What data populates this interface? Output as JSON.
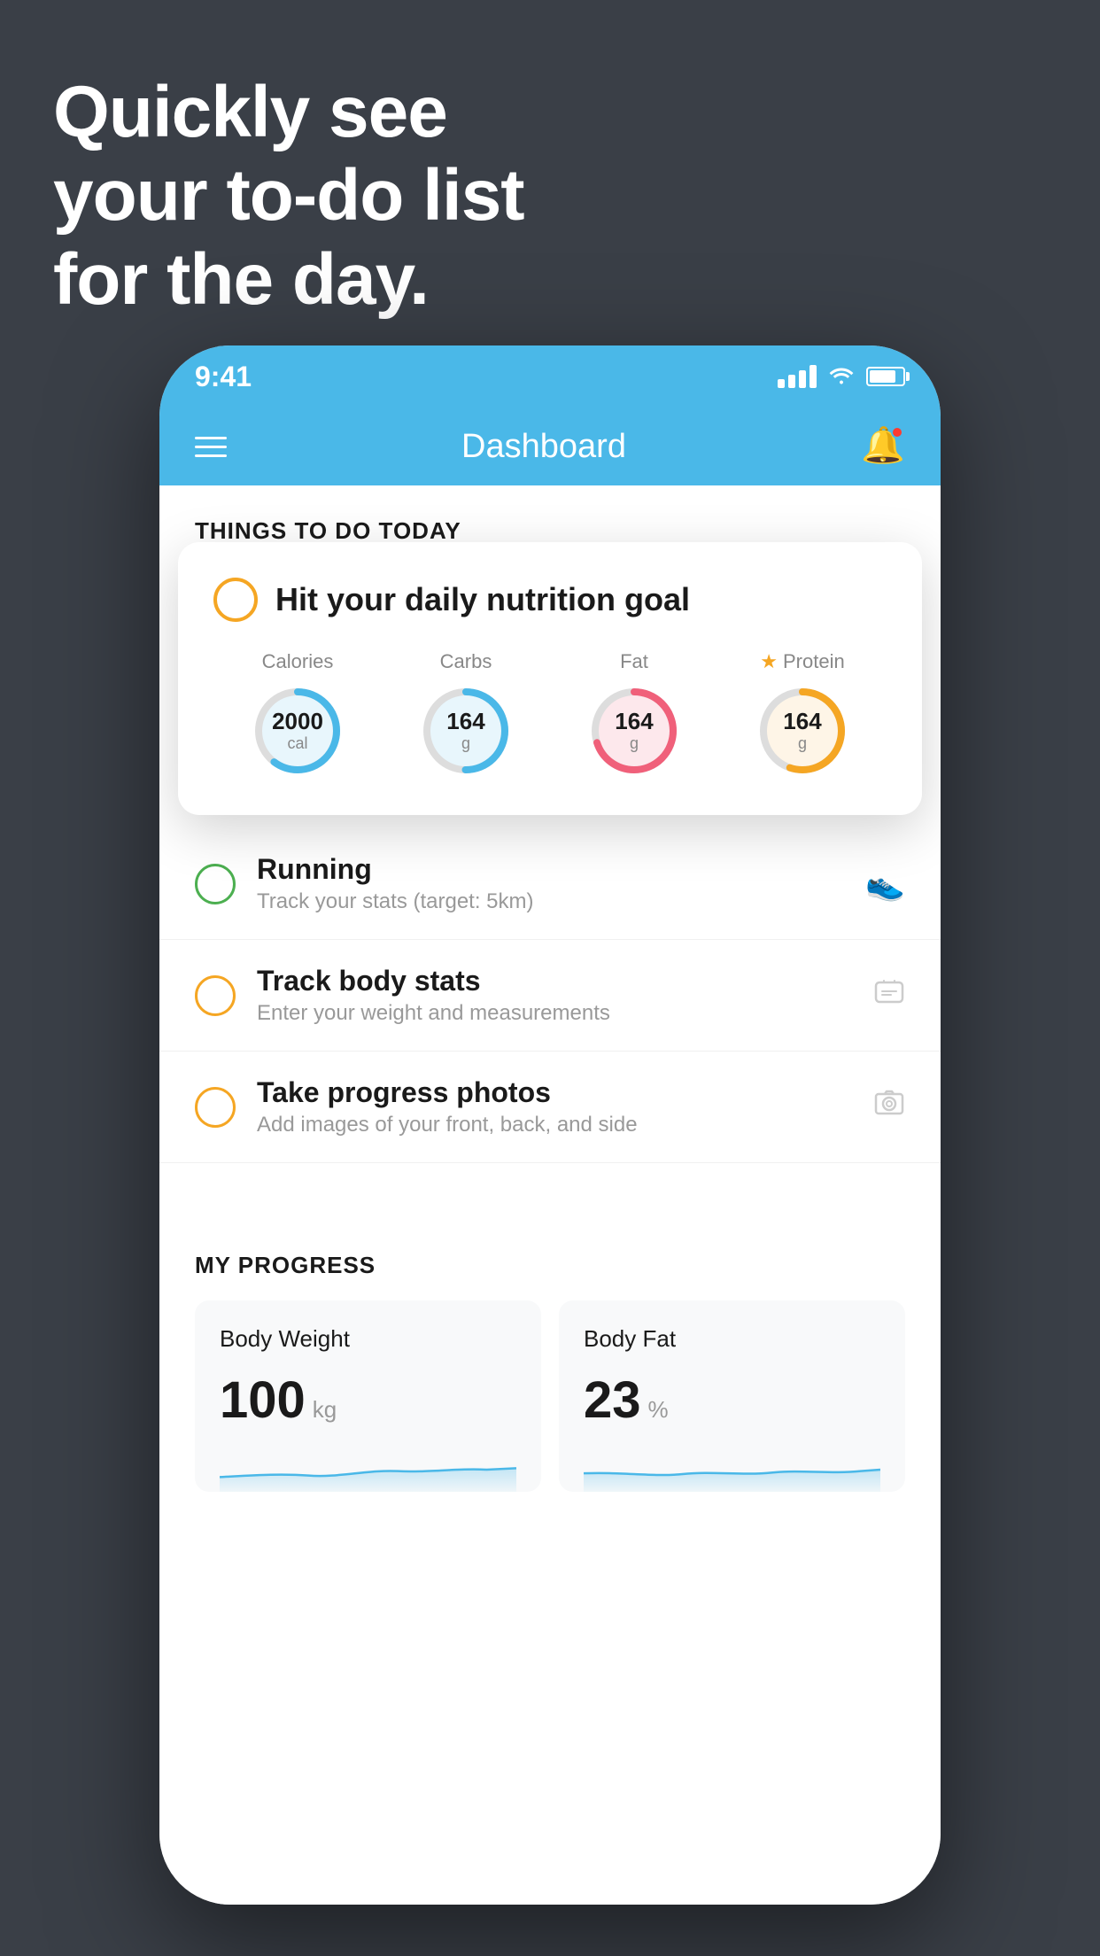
{
  "headline": {
    "line1": "Quickly see",
    "line2": "your to-do list",
    "line3": "for the day."
  },
  "phone": {
    "statusBar": {
      "time": "9:41"
    },
    "navBar": {
      "title": "Dashboard"
    },
    "sectionHeader": "THINGS TO DO TODAY",
    "floatingCard": {
      "title": "Hit your daily nutrition goal",
      "nutrition": [
        {
          "label": "Calories",
          "value": "2000",
          "unit": "cal",
          "color": "#4ab8e8",
          "bgColor": "#e8f6fc",
          "percent": 60,
          "star": false
        },
        {
          "label": "Carbs",
          "value": "164",
          "unit": "g",
          "color": "#4ab8e8",
          "bgColor": "#e8f6fc",
          "percent": 50,
          "star": false
        },
        {
          "label": "Fat",
          "value": "164",
          "unit": "g",
          "color": "#f0607a",
          "bgColor": "#fde8ec",
          "percent": 70,
          "star": false
        },
        {
          "label": "Protein",
          "value": "164",
          "unit": "g",
          "color": "#f5a623",
          "bgColor": "#fef5e7",
          "percent": 55,
          "star": true
        }
      ]
    },
    "todoItems": [
      {
        "title": "Running",
        "subtitle": "Track your stats (target: 5km)",
        "checkColor": "green",
        "icon": "👟"
      },
      {
        "title": "Track body stats",
        "subtitle": "Enter your weight and measurements",
        "checkColor": "orange",
        "icon": "⚖️"
      },
      {
        "title": "Take progress photos",
        "subtitle": "Add images of your front, back, and side",
        "checkColor": "orange",
        "icon": "🖼️"
      }
    ],
    "progressSection": {
      "header": "MY PROGRESS",
      "cards": [
        {
          "label": "Body Weight",
          "value": "100",
          "unit": "kg"
        },
        {
          "label": "Body Fat",
          "value": "23",
          "unit": "%"
        }
      ]
    }
  }
}
